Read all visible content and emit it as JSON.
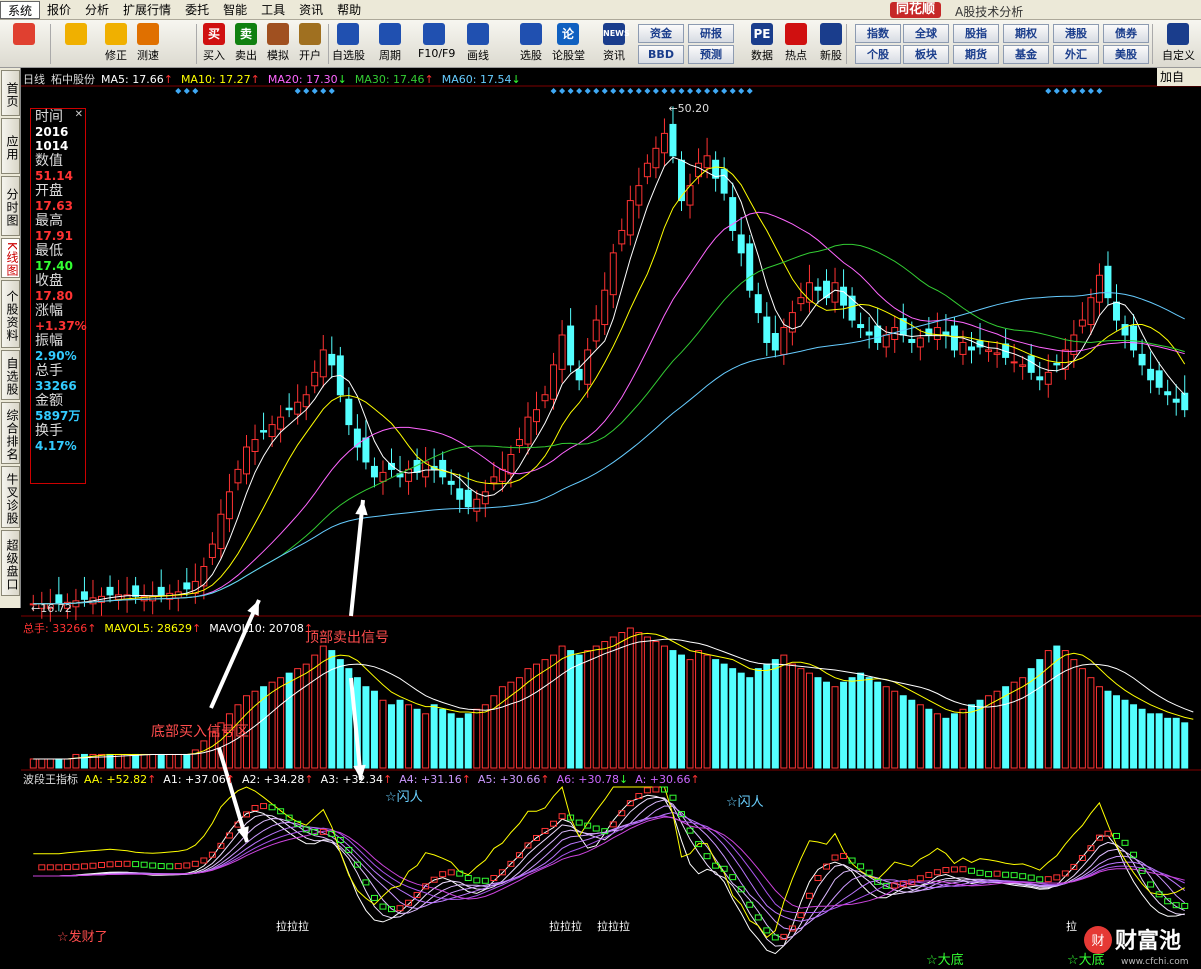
{
  "menu": [
    "系统",
    "报价",
    "分析",
    "扩展行情",
    "委托",
    "智能",
    "工具",
    "资讯",
    "帮助"
  ],
  "brand": "同花顺",
  "subtitle": "A股技术分析",
  "toolbar": {
    "buttons": [
      {
        "label": "",
        "icon": "grid-icon",
        "color": "#e04030"
      },
      {
        "label": "",
        "icon": "back-arrow-icon",
        "color": "#f0b000"
      },
      {
        "label": "修正",
        "icon": "up-down-arrow-icon",
        "color": "#f0b000"
      },
      {
        "label": "测速",
        "icon": "clock-icon",
        "color": "#e07000"
      },
      {
        "label": "买入",
        "icon": "buy-icon",
        "color": "#d01010",
        "text": "买"
      },
      {
        "label": "卖出",
        "icon": "sell-icon",
        "color": "#108010",
        "text": "卖"
      },
      {
        "label": "模拟",
        "icon": "hammer-icon",
        "color": "#a05020"
      },
      {
        "label": "开户",
        "icon": "lock-icon",
        "color": "#a07020"
      },
      {
        "label": "自选股",
        "icon": "star-icon",
        "color": "#2050b0"
      },
      {
        "label": "周期",
        "icon": "cycle-icon",
        "color": "#2050b0"
      },
      {
        "label": "F10/F9",
        "icon": "f10-icon",
        "color": "#2050b0"
      },
      {
        "label": "画线",
        "icon": "pen-icon",
        "color": "#2050b0"
      },
      {
        "label": "选股",
        "icon": "select-stock-icon",
        "color": "#2050b0"
      },
      {
        "label": "论股堂",
        "icon": "forum-icon",
        "color": "#1060c0",
        "text": "论"
      },
      {
        "label": "资讯",
        "icon": "news-icon",
        "color": "#1a3d8c",
        "text": "NEWS"
      },
      {
        "label": "数据",
        "icon": "pe-icon",
        "color": "#1a3d8c",
        "text": "PE"
      },
      {
        "label": "热点",
        "icon": "hot-icon",
        "color": "#d01010"
      },
      {
        "label": "新股",
        "icon": "new-stock-icon",
        "color": "#1a3d8c"
      },
      {
        "label": "自定义",
        "icon": "customize-icon",
        "color": "#1a3d8c"
      }
    ],
    "grid_buttons": [
      "资金",
      "研报",
      "BBD",
      "预测",
      "指数",
      "全球",
      "股指",
      "期权",
      "港股",
      "债券",
      "个股",
      "板块",
      "期货",
      "基金",
      "外汇",
      "美股"
    ]
  },
  "sidebar": [
    "首页",
    "应用",
    "分时图",
    "K线图",
    "个股资料",
    "自选股",
    "综合排名",
    "牛叉诊股",
    "超级盘口"
  ],
  "kline_header": {
    "period": "日线",
    "stock": "柘中股份",
    "ma": [
      {
        "label": "MA5: 17.66",
        "arrow": "↑",
        "color": "#ffffff"
      },
      {
        "label": "MA10: 17.27",
        "arrow": "↑",
        "color": "#ffff00"
      },
      {
        "label": "MA20: 17.30",
        "arrow": "↓",
        "color": "#ff66ff"
      },
      {
        "label": "MA30: 17.46",
        "arrow": "↑",
        "color": "#33cc33"
      },
      {
        "label": "MA60: 17.54",
        "arrow": "↓",
        "color": "#66ccff"
      }
    ],
    "right_label": "加自"
  },
  "info_panel": {
    "items": [
      {
        "label": "时间",
        "value": "2016",
        "color": "#ffffff"
      },
      {
        "label": "",
        "value": "1014",
        "color": "#ffffff"
      },
      {
        "label": "数值",
        "value": "51.14",
        "color": "#ff3333"
      },
      {
        "label": "开盘",
        "value": "17.63",
        "color": "#ff3333"
      },
      {
        "label": "最高",
        "value": "17.91",
        "color": "#ff3333"
      },
      {
        "label": "最低",
        "value": "17.40",
        "color": "#33ff33"
      },
      {
        "label": "收盘",
        "value": "17.80",
        "color": "#ff3333"
      },
      {
        "label": "涨幅",
        "value": "+1.37%",
        "color": "#ff3333"
      },
      {
        "label": "振幅",
        "value": "2.90%",
        "color": "#33ccff"
      },
      {
        "label": "总手",
        "value": "33266",
        "color": "#33ccff"
      },
      {
        "label": "金额",
        "value": "5897万",
        "color": "#33ccff"
      },
      {
        "label": "换手",
        "value": "4.17%",
        "color": "#33ccff"
      }
    ]
  },
  "price_marks": {
    "high": "50.20",
    "low": "16.72"
  },
  "volume_header": [
    {
      "label": "总手: 33266",
      "arrow": "↑",
      "color": "#ff3333"
    },
    {
      "label": "MAVOL5: 28629",
      "arrow": "↑",
      "color": "#ffff00"
    },
    {
      "label": "MAVOL10: 20708",
      "arrow": "↑",
      "color": "#ffffff"
    }
  ],
  "indicator_header": {
    "name": "波段王指标",
    "items": [
      {
        "label": "AA: +52.82",
        "arrow": "↑",
        "color": "#ffff00"
      },
      {
        "label": "A1: +37.06",
        "arrow": "↑",
        "color": "#ffffff"
      },
      {
        "label": "A2: +34.28",
        "arrow": "↑",
        "color": "#ffffff"
      },
      {
        "label": "A3: +32.34",
        "arrow": "↑",
        "color": "#ffffff"
      },
      {
        "label": "A4: +31.16",
        "arrow": "↑",
        "color": "#cc99ff"
      },
      {
        "label": "A5: +30.66",
        "arrow": "↑",
        "color": "#cc99ff"
      },
      {
        "label": "A6: +30.78",
        "arrow": "↓",
        "color": "#cc66ff"
      },
      {
        "label": "A: +30.66",
        "arrow": "↑",
        "color": "#cc66ff"
      }
    ]
  },
  "annotations": {
    "top_sell": "顶部卖出信号",
    "bottom_buy": "底部买入信号区",
    "flash1": "☆闪人",
    "flash2": "☆闪人",
    "fortune": "☆发财了",
    "bottom1": "☆大底",
    "bottom2": "☆大底",
    "pull_labels": [
      "拉拉拉",
      "拉拉拉",
      "拉拉拉",
      "拉"
    ]
  },
  "watermark": {
    "text": "财富池",
    "sub": "www.cfchi.com"
  },
  "colors": {
    "up": "#ff3333",
    "down": "#54ffff",
    "grid": "#800000"
  },
  "chart_data": {
    "type": "candlestick",
    "stock": "柘中股份",
    "period": "日线",
    "price_range": [
      16.72,
      50.2
    ],
    "close_series": [
      17.0,
      17.0,
      17.0,
      17.0,
      17.1,
      17.2,
      17.3,
      17.4,
      17.5,
      17.6,
      17.6,
      17.6,
      17.5,
      17.5,
      17.5,
      17.6,
      17.7,
      17.8,
      18.0,
      18.5,
      19.5,
      21.0,
      23.0,
      24.5,
      26.0,
      27.5,
      28.0,
      28.5,
      29.0,
      29.5,
      30.0,
      30.5,
      31.0,
      32.5,
      34.0,
      33.0,
      31.0,
      29.0,
      27.5,
      26.5,
      25.5,
      25.8,
      26.0,
      25.5,
      26.0,
      25.8,
      26.5,
      26.0,
      25.5,
      25.0,
      24.0,
      23.5,
      24.0,
      24.5,
      25.5,
      26.0,
      27.0,
      28.0,
      29.5,
      30.0,
      31.0,
      33.0,
      35.0,
      33.0,
      32.0,
      34.0,
      36.0,
      38.0,
      40.5,
      42.0,
      44.0,
      45.0,
      46.5,
      47.5,
      48.5,
      47.0,
      44.0,
      45.0,
      46.5,
      47.0,
      45.5,
      44.5,
      42.0,
      40.5,
      38.0,
      36.5,
      34.5,
      34.0,
      35.5,
      36.5,
      37.5,
      38.5,
      38.0,
      37.5,
      38.5,
      37.0,
      36.0,
      35.5,
      35.0,
      34.5,
      35.0,
      35.5,
      35.0,
      34.5,
      34.8,
      35.0,
      35.5,
      35.0,
      34.0,
      34.5,
      34.0,
      34.2,
      34.0,
      33.8,
      33.5,
      33.2,
      33.0,
      32.5,
      32.0,
      32.5,
      33.0,
      34.0,
      35.0,
      36.0,
      37.5,
      39.0,
      37.5,
      36.0,
      35.0,
      34.0,
      33.0,
      32.0,
      31.5,
      31.0,
      30.5,
      30.0
    ],
    "volume": [
      2,
      2,
      2,
      2,
      2,
      3,
      3,
      3,
      3,
      3,
      3,
      3,
      3,
      3,
      3,
      3,
      3,
      3,
      3,
      4,
      6,
      8,
      10,
      12,
      14,
      16,
      17,
      18,
      19,
      20,
      21,
      22,
      23,
      25,
      27,
      26,
      24,
      22,
      20,
      18,
      17,
      15,
      14,
      15,
      14,
      13,
      12,
      14,
      13,
      12,
      11,
      12,
      13,
      14,
      16,
      18,
      19,
      20,
      22,
      23,
      24,
      25,
      27,
      26,
      25,
      26,
      27,
      28,
      29,
      30,
      31,
      30,
      29,
      28,
      27,
      26,
      25,
      24,
      26,
      25,
      24,
      23,
      22,
      21,
      20,
      22,
      23,
      24,
      25,
      23,
      22,
      21,
      20,
      19,
      18,
      19,
      20,
      21,
      20,
      19,
      18,
      17,
      16,
      15,
      14,
      13,
      12,
      11,
      12,
      13,
      14,
      15,
      16,
      17,
      18,
      19,
      20,
      22,
      24,
      26,
      27,
      26,
      24,
      22,
      20,
      18,
      17,
      16,
      15,
      14,
      13,
      12,
      12,
      11,
      11,
      10,
      10
    ]
  }
}
